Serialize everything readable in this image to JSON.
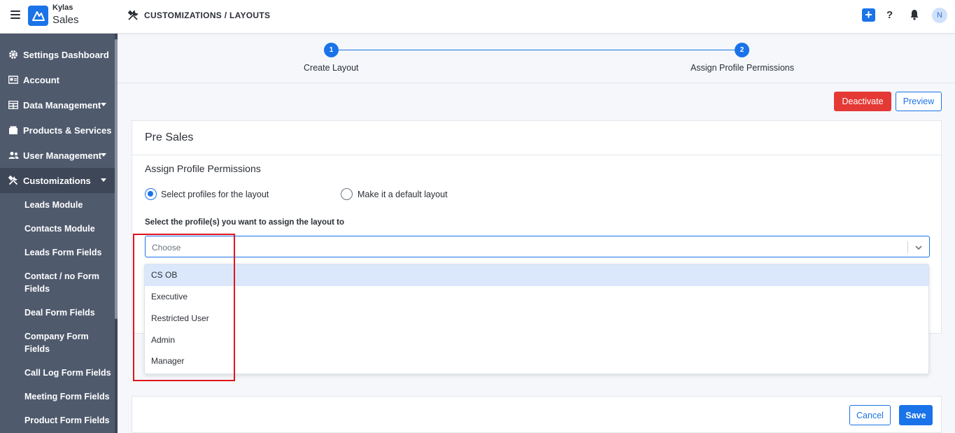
{
  "app": {
    "brand_top": "Kylas",
    "brand_bottom": "Sales"
  },
  "header": {
    "breadcrumb": "CUSTOMIZATIONS / LAYOUTS",
    "plus_label": "+",
    "help_label": "?",
    "avatar_initial": "N"
  },
  "sidebar": {
    "items": [
      {
        "label": "Settings Dashboard",
        "icon": "gear-icon"
      },
      {
        "label": "Account",
        "icon": "id-card-icon"
      },
      {
        "label": "Data Management",
        "icon": "table-icon"
      },
      {
        "label": "Products & Services",
        "icon": "box-icon"
      },
      {
        "label": "User Management",
        "icon": "users-icon"
      },
      {
        "label": "Customizations",
        "icon": "tools-icon"
      }
    ],
    "sub_items": [
      "Leads Module",
      "Contacts Module",
      "Leads Form Fields",
      "Contact / no Form Fields",
      "Deal Form Fields",
      "Company Form Fields",
      "Call Log Form Fields",
      "Meeting Form Fields",
      "Product Form Fields"
    ]
  },
  "stepper": {
    "steps": [
      {
        "number": "1",
        "label": "Create Layout"
      },
      {
        "number": "2",
        "label": "Assign Profile Permissions"
      }
    ]
  },
  "actions": {
    "deactivate": "Deactivate",
    "preview": "Preview"
  },
  "card": {
    "title": "Pre Sales",
    "section_title": "Assign Profile Permissions",
    "radio_options": [
      {
        "label": "Select profiles for the layout",
        "selected": true
      },
      {
        "label": "Make it a default layout",
        "selected": false
      }
    ],
    "field_label": "Select the profile(s) you want to assign the layout to",
    "select_placeholder": "Choose"
  },
  "dropdown": {
    "options": [
      "CS OB",
      "Executive",
      "Restricted User",
      "Admin",
      "Manager"
    ],
    "highlighted": "CS OB"
  },
  "footer": {
    "cancel": "Cancel",
    "save": "Save"
  },
  "colors": {
    "accent": "#1a73e8",
    "danger": "#e53935",
    "sidebar": "#4f5a6d",
    "annotation": "#e0141e"
  }
}
